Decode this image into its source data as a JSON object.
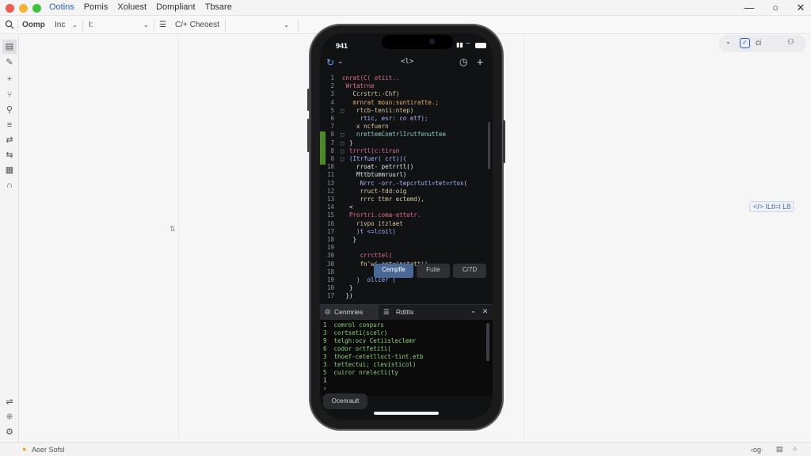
{
  "menubar": {
    "app_name": "Ootins",
    "items": [
      "Pomis",
      "Xoluest",
      "Dompliant",
      "Tbsare"
    ]
  },
  "toolbar": {
    "comp": "Oomp",
    "select1": "Inc",
    "select2": "I:",
    "encoding": "C/+ Cheoest"
  },
  "canvas": {
    "float_icon_label": "ci",
    "side_chip": "</> ILtl=l L8",
    "drag_handle": "⇅"
  },
  "phone": {
    "time": "941",
    "header_title": "<l>",
    "code_lines": [
      {
        "n": "1",
        "m": "",
        "t": "cnrat(C( otiit..",
        "c": "k"
      },
      {
        "n": "2",
        "m": "",
        "t": " Wrtatrne",
        "c": "k"
      },
      {
        "n": "3",
        "m": "",
        "t": "   Ccrstrt:-Chf)",
        "c": "f"
      },
      {
        "n": "4",
        "m": "",
        "t": "   mrnrat moun:suntiratte.;",
        "c": "o"
      },
      {
        "n": "5",
        "m": "□",
        "t": "    rtcb-tenii:ntep)",
        "c": "f"
      },
      {
        "n": "6",
        "m": "",
        "t": "     rtic, esr: co etf);",
        "c": "v"
      },
      {
        "n": "7",
        "m": "",
        "t": "    x ncfuern",
        "c": "f"
      },
      {
        "n": "8",
        "m": "□",
        "t": "    nrettemComtrlIrutfenuttee",
        "c": "s"
      },
      {
        "n": "7",
        "m": "□",
        "t": "  }",
        "c": "w"
      },
      {
        "n": "8",
        "m": "□",
        "t": "  trrrtl(c:tirun",
        "c": "k"
      },
      {
        "n": "0",
        "m": "□",
        "t": "  (Itrfuer( crt))(",
        "c": "v"
      },
      {
        "n": "10",
        "m": "",
        "t": "    rroat- petrrtl()",
        "c": "w"
      },
      {
        "n": "11",
        "m": "",
        "t": "    Mttbtummruurl)",
        "c": "w"
      },
      {
        "n": "13",
        "m": "",
        "t": "     Nrrc -orr.-tepcrtutl=tet=rtos(",
        "c": "v"
      },
      {
        "n": "12",
        "m": "",
        "t": "     rruct-tdd:oig",
        "c": "f"
      },
      {
        "n": "13",
        "m": "",
        "t": "     rrrc ttmr ectemd),",
        "c": "f"
      },
      {
        "n": "14",
        "m": "",
        "t": "  <",
        "c": "w"
      },
      {
        "n": "15",
        "m": "",
        "t": "  Prortri.coma-ettetr.",
        "c": "k"
      },
      {
        "n": "16",
        "m": "",
        "t": "    rivpo itzlaet",
        "c": "f"
      },
      {
        "n": "17",
        "m": "",
        "t": "    )t <=lcoil)",
        "c": "v"
      },
      {
        "n": "18",
        "m": "",
        "t": "   }",
        "c": "w"
      },
      {
        "n": "19",
        "m": "",
        "t": "",
        "c": "w"
      },
      {
        "n": "30",
        "m": "",
        "t": "     crrcttel(",
        "c": "k"
      },
      {
        "n": "30",
        "m": "",
        "t": "     fn'w( ont=ipstatt))",
        "c": "f"
      },
      {
        "n": "18",
        "m": "",
        "t": "",
        "c": "w"
      },
      {
        "n": "19",
        "m": "",
        "t": "    )  ollcer (",
        "c": "v"
      },
      {
        "n": "10",
        "m": "",
        "t": "  }",
        "c": "w"
      },
      {
        "n": "17",
        "m": "",
        "t": " })",
        "c": "w"
      }
    ],
    "chips": [
      "Cempfle",
      "Fuite",
      "C/7D"
    ],
    "panel_tab1": "Cenmries",
    "panel_tab2": "Rdttts",
    "console_lines": [
      "1  comrol conpurs",
      "3  cortseti(scelr)",
      "9  telgh:ocv Cetiisleclemr",
      "6  codor ortfetiti(",
      "3  thoef-cetetlloct-tint.etb",
      "3  tettectui; clevisticol)",
      "5  cuiror nrelecti(ty",
      "1",
      "›"
    ],
    "bottom_pill": "Ocenrault"
  },
  "statusbar": {
    "left": "Aoer Sofsl",
    "right": "‹og·"
  }
}
